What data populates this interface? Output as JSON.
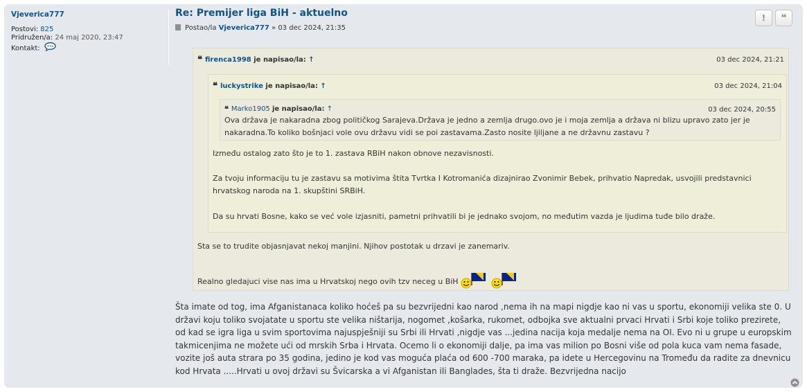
{
  "profile": {
    "username": "Vjeverica777",
    "posts_label": "Postovi:",
    "posts_value": "825",
    "joined_label": "Pridružen/a:",
    "joined_value": "24 maj 2020, 23:47",
    "contact_label": "Kontakt:"
  },
  "post": {
    "title": "Re: Premijer liga BiH - aktuelno",
    "by_label": "Postao/la",
    "author": "Vjeverica777",
    "separator": "»",
    "date": "03 dec 2024, 21:35",
    "report_label": "!",
    "quote_label": "❝",
    "body": "Šta imate od tog, ima Afganistanaca koliko hoćeš pa su bezvrijedni kao narod ,nema ih na mapi nigdje kao ni vas u sportu, ekonomiji velika ste 0. U državi koju toliko svojatate u sportu ste velika ništarija, nogomet ,košarka, rukomet, odbojka sve aktualni prvaci Hrvati i Srbi koje toliko prezirete, od kad se igra liga u svim sportovima najuspješniji su Srbi ili Hrvati ,nigdje vas ...jedina nacija koja medalje nema na OI. Evo ni u grupe u europskim takmicenjima ne možete ući od mrskih Srba i Hrvata. Ocemo li o ekonomiji dalje, pa ima vas milion po Bosni više od pola kuca vam nema fasade, vozite još auta strara po 35 godina, jedino je kod vas moguća plaća od 600 -700 maraka, pa idete u Hercegovinu na Tromeđu da radite za dnevnicu kod Hrvata .....Hrvati u ovoj državi su Švicarska a vi Afganistan ili Banglades, šta ti draže. Bezvrijedna nacijo"
  },
  "quotes": {
    "wrote_label": "je napisao/la:",
    "up_arrow": "↑",
    "q1": {
      "author": "firenca1998",
      "date": "03 dec 2024, 21:21",
      "p1": "Sta se to trudite objasnjavat nekoj manjini. Njihov postotak u drzavi je zanemariv.",
      "p2": "Realno gledajuci vise nas ima u Hrvatskoj nego ovih tzv neceg u BiH"
    },
    "q2": {
      "author": "luckystrike",
      "date": "03 dec 2024, 21:04",
      "p1": "Između ostalog zato što je to 1. zastava RBiH nakon obnove nezavisnosti.",
      "p2": "Za tvoju informaciju tu je zastavu sa motivima štita Tvrtka I Kotromanića dizajnirao Zvonimir Bebek, prihvatio Napredak, usvojili predstavnici hrvatskog naroda na 1. skupštini SRBiH.",
      "p3": "Da su hrvati Bosne, kako se već vole izjasniti, pametni prihvatili bi je jednako svojom, no međutim vazda je ljudima tuđe bilo draže."
    },
    "q3": {
      "author": "Marko1905",
      "date": "03 dec 2024, 20:55",
      "text": "Ova država je nakaradna zbog političkog Sarajeva.Država je jedno a zemlja drugo.ovo je i moja zemlja a država ni blizu upravo zato jer je nakaradna.To koliko bošnjaci vole ovu državu vidi se poi zastavama.Zasto nosite ljiljane a ne državnu zastavu ?"
    }
  },
  "colors": {
    "link": "#105289",
    "post_bg": "#e5e9ed",
    "quote_bg": "#ebeadd",
    "quote_bg_inner": "#efeed9",
    "flag_blue": "#002395",
    "flag_yellow": "#fecb00"
  },
  "icons": [
    "chat-bubble-icon",
    "document-icon",
    "report-icon",
    "quote-icon",
    "smiley-flag-icon",
    "back-to-top-icon"
  ]
}
